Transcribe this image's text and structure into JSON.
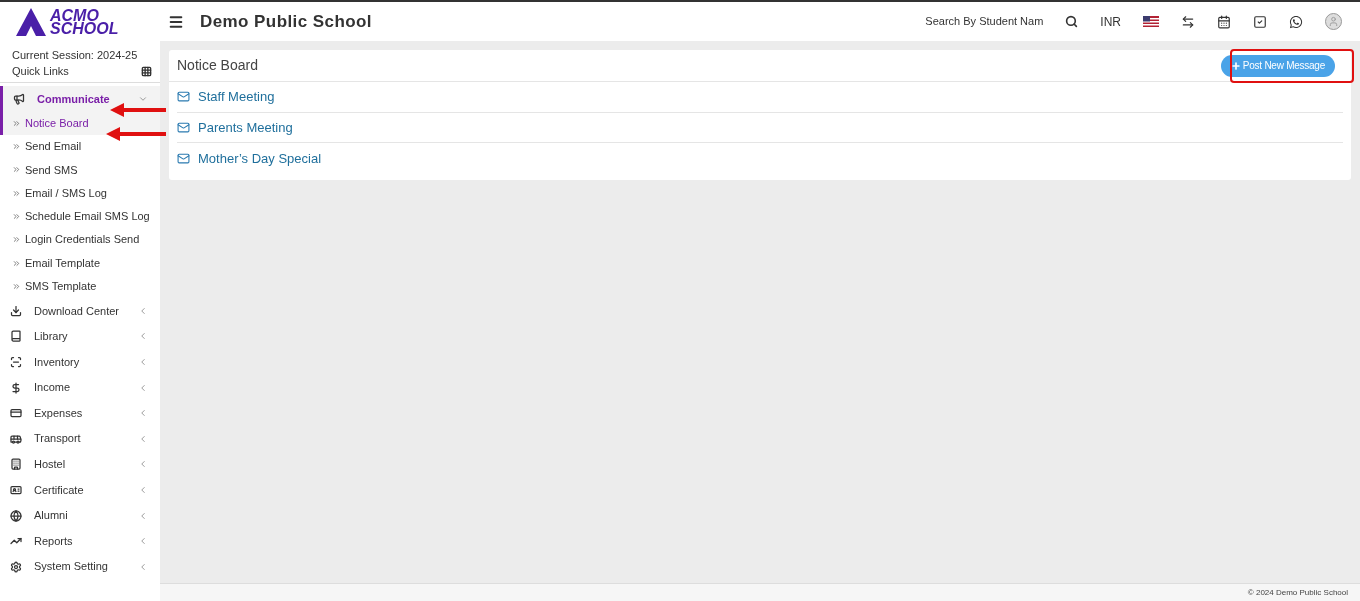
{
  "header": {
    "logo_top": "ACMO",
    "logo_bottom": "SCHOOL",
    "title": "Demo Public School",
    "search": {
      "placeholder": "Search By Student Nam"
    },
    "currency": "INR"
  },
  "sidebar": {
    "session": "Current Session: 2024-25",
    "quick_links": "Quick Links",
    "items": [
      {
        "label": "Communicate",
        "selected": true,
        "expanded": true,
        "children": [
          {
            "label": "Notice Board",
            "selected": true
          },
          {
            "label": "Send Email",
            "selected": false
          },
          {
            "label": "Send SMS",
            "selected": false
          },
          {
            "label": "Email / SMS Log",
            "selected": false
          },
          {
            "label": "Schedule Email SMS Log",
            "selected": false
          },
          {
            "label": "Login Credentials Send",
            "selected": false
          },
          {
            "label": "Email Template",
            "selected": false
          },
          {
            "label": "SMS Template",
            "selected": false
          }
        ]
      },
      {
        "label": "Download Center",
        "selected": false,
        "expanded": false
      },
      {
        "label": "Library",
        "selected": false,
        "expanded": false
      },
      {
        "label": "Inventory",
        "selected": false,
        "expanded": false
      },
      {
        "label": "Income",
        "selected": false,
        "expanded": false
      },
      {
        "label": "Expenses",
        "selected": false,
        "expanded": false
      },
      {
        "label": "Transport",
        "selected": false,
        "expanded": false
      },
      {
        "label": "Hostel",
        "selected": false,
        "expanded": false
      },
      {
        "label": "Certificate",
        "selected": false,
        "expanded": false
      },
      {
        "label": "Alumni",
        "selected": false,
        "expanded": false
      },
      {
        "label": "Reports",
        "selected": false,
        "expanded": false
      },
      {
        "label": "System Setting",
        "selected": false,
        "expanded": false
      }
    ]
  },
  "notice_board": {
    "title": "Notice Board",
    "button": "Post New Message",
    "notices": [
      "Staff Meeting",
      "Parents Meeting",
      "Mother’s Day Special"
    ]
  },
  "footer": "© 2024 Demo Public School"
}
